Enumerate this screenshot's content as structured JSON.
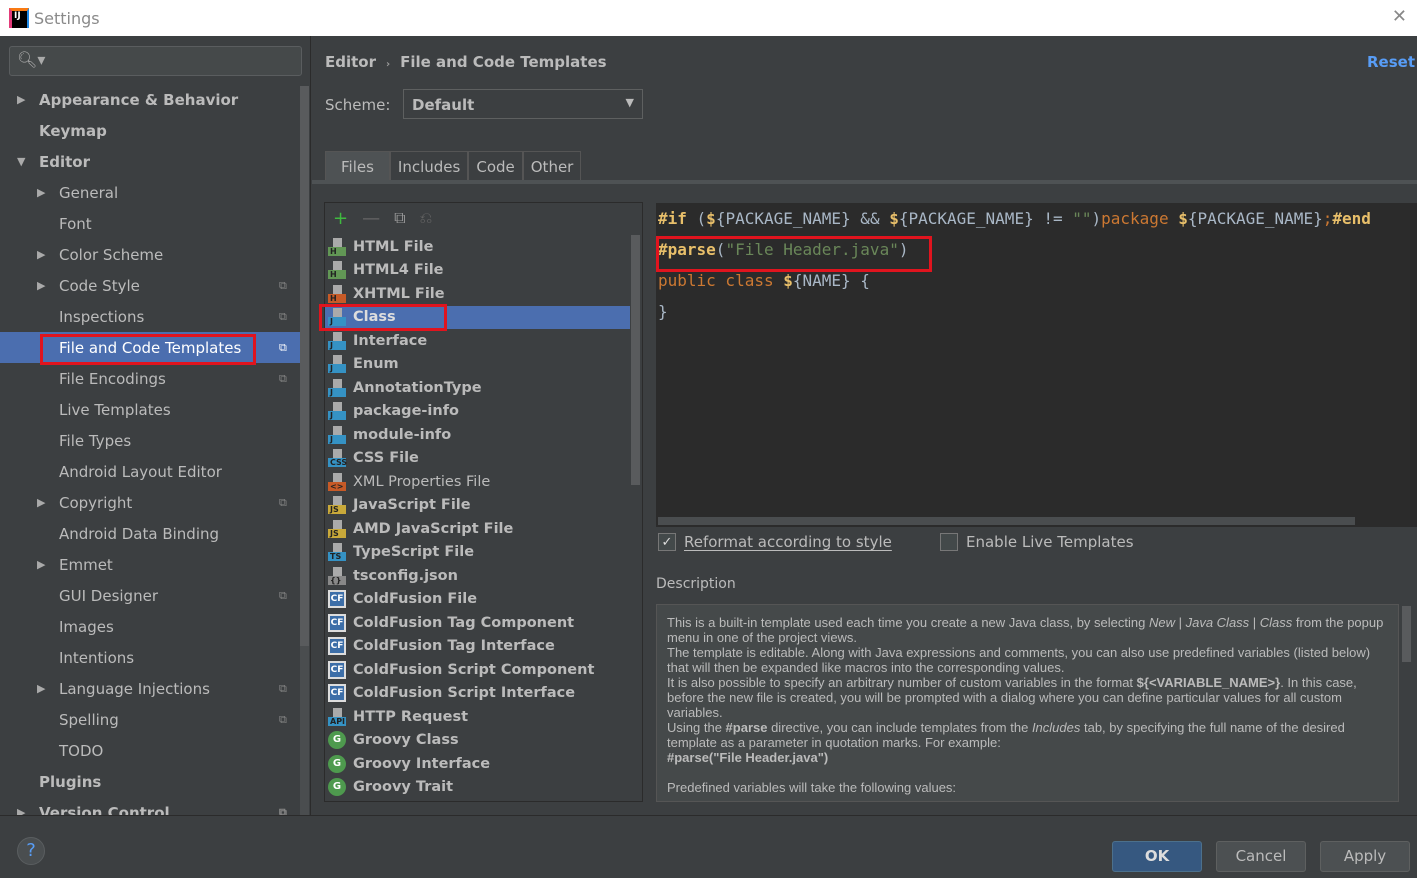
{
  "window": {
    "title": "Settings"
  },
  "search": {
    "placeholder": ""
  },
  "sidebar": {
    "items": [
      {
        "label": "Appearance & Behavior",
        "level": 0,
        "arrow": "right",
        "bold": true,
        "copy": false
      },
      {
        "label": "Keymap",
        "level": 0,
        "arrow": "",
        "bold": true,
        "copy": false
      },
      {
        "label": "Editor",
        "level": 0,
        "arrow": "down",
        "bold": true,
        "copy": false
      },
      {
        "label": "General",
        "level": 1,
        "arrow": "right",
        "bold": false,
        "copy": false
      },
      {
        "label": "Font",
        "level": 1,
        "arrow": "",
        "bold": false,
        "copy": false
      },
      {
        "label": "Color Scheme",
        "level": 1,
        "arrow": "right",
        "bold": false,
        "copy": false
      },
      {
        "label": "Code Style",
        "level": 1,
        "arrow": "right",
        "bold": false,
        "copy": true
      },
      {
        "label": "Inspections",
        "level": 1,
        "arrow": "",
        "bold": false,
        "copy": true
      },
      {
        "label": "File and Code Templates",
        "level": 1,
        "arrow": "",
        "bold": false,
        "copy": true,
        "selected": true
      },
      {
        "label": "File Encodings",
        "level": 1,
        "arrow": "",
        "bold": false,
        "copy": true
      },
      {
        "label": "Live Templates",
        "level": 1,
        "arrow": "",
        "bold": false,
        "copy": false
      },
      {
        "label": "File Types",
        "level": 1,
        "arrow": "",
        "bold": false,
        "copy": false
      },
      {
        "label": "Android Layout Editor",
        "level": 1,
        "arrow": "",
        "bold": false,
        "copy": false
      },
      {
        "label": "Copyright",
        "level": 1,
        "arrow": "right",
        "bold": false,
        "copy": true
      },
      {
        "label": "Android Data Binding",
        "level": 1,
        "arrow": "",
        "bold": false,
        "copy": false
      },
      {
        "label": "Emmet",
        "level": 1,
        "arrow": "right",
        "bold": false,
        "copy": false
      },
      {
        "label": "GUI Designer",
        "level": 1,
        "arrow": "",
        "bold": false,
        "copy": true
      },
      {
        "label": "Images",
        "level": 1,
        "arrow": "",
        "bold": false,
        "copy": false
      },
      {
        "label": "Intentions",
        "level": 1,
        "arrow": "",
        "bold": false,
        "copy": false
      },
      {
        "label": "Language Injections",
        "level": 1,
        "arrow": "right",
        "bold": false,
        "copy": true
      },
      {
        "label": "Spelling",
        "level": 1,
        "arrow": "",
        "bold": false,
        "copy": true
      },
      {
        "label": "TODO",
        "level": 1,
        "arrow": "",
        "bold": false,
        "copy": false
      },
      {
        "label": "Plugins",
        "level": 0,
        "arrow": "",
        "bold": true,
        "copy": false
      },
      {
        "label": "Version Control",
        "level": 0,
        "arrow": "right",
        "bold": true,
        "copy": true
      }
    ]
  },
  "header": {
    "breadcrumb": [
      "Editor",
      "File and Code Templates"
    ],
    "reset": "Reset"
  },
  "scheme": {
    "label": "Scheme:",
    "value": "Default"
  },
  "tabs": [
    {
      "label": "Files",
      "active": true
    },
    {
      "label": "Includes"
    },
    {
      "label": "Code"
    },
    {
      "label": "Other"
    }
  ],
  "templates": [
    {
      "label": "HTML File",
      "icon": "H",
      "color": "#629755"
    },
    {
      "label": "HTML4 File",
      "icon": "H",
      "color": "#629755"
    },
    {
      "label": "XHTML File",
      "icon": "H",
      "color": "#c75a27"
    },
    {
      "label": "Class",
      "icon": "J",
      "color": "#3592c4",
      "selected": true
    },
    {
      "label": "Interface",
      "icon": "J",
      "color": "#3592c4"
    },
    {
      "label": "Enum",
      "icon": "J",
      "color": "#3592c4"
    },
    {
      "label": "AnnotationType",
      "icon": "J",
      "color": "#3592c4"
    },
    {
      "label": "package-info",
      "icon": "J",
      "color": "#3592c4"
    },
    {
      "label": "module-info",
      "icon": "J",
      "color": "#3592c4"
    },
    {
      "label": "CSS File",
      "icon": "CSS",
      "color": "#3592c4"
    },
    {
      "label": "XML Properties File",
      "icon": "<>",
      "color": "#c75a27",
      "normal": true
    },
    {
      "label": "JavaScript File",
      "icon": "JS",
      "color": "#c9a93a"
    },
    {
      "label": "AMD JavaScript File",
      "icon": "JS",
      "color": "#c9a93a"
    },
    {
      "label": "TypeScript File",
      "icon": "TS",
      "color": "#3592c4"
    },
    {
      "label": "tsconfig.json",
      "icon": "{}",
      "color": "#888888"
    },
    {
      "label": "ColdFusion File",
      "icon": "CF",
      "type": "box"
    },
    {
      "label": "ColdFusion Tag Component",
      "icon": "CF",
      "type": "box"
    },
    {
      "label": "ColdFusion Tag Interface",
      "icon": "CF",
      "type": "box"
    },
    {
      "label": "ColdFusion Script Component",
      "icon": "CF",
      "type": "box"
    },
    {
      "label": "ColdFusion Script Interface",
      "icon": "CF",
      "type": "box"
    },
    {
      "label": "HTTP Request",
      "icon": "API",
      "color": "#3592c4"
    },
    {
      "label": "Groovy Class",
      "icon": "G",
      "type": "round",
      "color": "#4e9a4e"
    },
    {
      "label": "Groovy Interface",
      "icon": "G",
      "type": "round",
      "color": "#4e9a4e"
    },
    {
      "label": "Groovy Trait",
      "icon": "G",
      "type": "round",
      "color": "#4e9a4e"
    }
  ],
  "code": {
    "lines": [
      [
        {
          "t": "#if",
          "c": "#e8bf6a",
          "b": true
        },
        {
          "t": " (",
          "c": "#a9b7c6"
        },
        {
          "t": "$",
          "c": "#e8bf6a",
          "b": true
        },
        {
          "t": "{PACKAGE_NAME}",
          "c": "#a9b7c6"
        },
        {
          "t": " && ",
          "c": "#a9b7c6"
        },
        {
          "t": "$",
          "c": "#e8bf6a",
          "b": true
        },
        {
          "t": "{PACKAGE_NAME}",
          "c": "#a9b7c6"
        },
        {
          "t": " != ",
          "c": "#a9b7c6"
        },
        {
          "t": "\"\"",
          "c": "#6a8759"
        },
        {
          "t": ")",
          "c": "#a9b7c6"
        },
        {
          "t": "package ",
          "c": "#cc7832"
        },
        {
          "t": "$",
          "c": "#e8bf6a",
          "b": true
        },
        {
          "t": "{PACKAGE_NAME}",
          "c": "#a9b7c6"
        },
        {
          "t": ";",
          "c": "#cc7832"
        },
        {
          "t": "#end",
          "c": "#e8bf6a",
          "b": true
        }
      ],
      [
        {
          "t": "#parse",
          "c": "#e8bf6a",
          "b": true
        },
        {
          "t": "(",
          "c": "#a9b7c6"
        },
        {
          "t": "\"File Header.java\"",
          "c": "#6a8759"
        },
        {
          "t": ")",
          "c": "#a9b7c6"
        }
      ],
      [
        {
          "t": "public class ",
          "c": "#cc7832"
        },
        {
          "t": "$",
          "c": "#e8bf6a",
          "b": true
        },
        {
          "t": "{NAME}",
          "c": "#a9b7c6"
        },
        {
          "t": " {",
          "c": "#a9b7c6"
        }
      ],
      [
        {
          "t": "}",
          "c": "#a9b7c6"
        }
      ]
    ]
  },
  "options": {
    "reformat": {
      "label": "Reformat according to style",
      "checked": true
    },
    "live": {
      "label": "Enable Live Templates",
      "checked": false
    }
  },
  "description": {
    "label": "Description",
    "paragraphs": [
      [
        {
          "t": "This is a built-in template used each time you create a new Java class, by selecting "
        },
        {
          "t": "New",
          "i": true
        },
        {
          "t": " | "
        },
        {
          "t": "Java Class",
          "i": true
        },
        {
          "t": " | "
        },
        {
          "t": "Class",
          "i": true
        },
        {
          "t": " from the popup menu in one of the project views."
        }
      ],
      [
        {
          "t": "The template is editable. Along with Java expressions and comments, you can also use predefined variables (listed below) that will then be expanded like macros into the corresponding values."
        }
      ],
      [
        {
          "t": "It is also possible to specify an arbitrary number of custom variables in the format "
        },
        {
          "t": "${<VARIABLE_NAME>}",
          "b": true
        },
        {
          "t": ". In this case, before the new file is created, you will be prompted with a dialog where you can define particular values for all custom variables."
        }
      ],
      [
        {
          "t": "Using the "
        },
        {
          "t": "#parse",
          "b": true
        },
        {
          "t": " directive, you can include templates from the "
        },
        {
          "t": "Includes",
          "i": true
        },
        {
          "t": " tab, by specifying the full name of the desired template as a parameter in quotation marks. For example:"
        }
      ],
      [
        {
          "t": "#parse(\"File Header.java\")",
          "b": true
        }
      ],
      [
        {
          "t": " "
        }
      ],
      [
        {
          "t": "Predefined variables will take the following values:"
        }
      ]
    ]
  },
  "buttons": {
    "ok": "OK",
    "cancel": "Cancel",
    "apply": "Apply",
    "help": "?"
  },
  "colors": {
    "accent": "#4b6eaf",
    "highlight_box": "#e0141e",
    "link": "#589df6"
  }
}
